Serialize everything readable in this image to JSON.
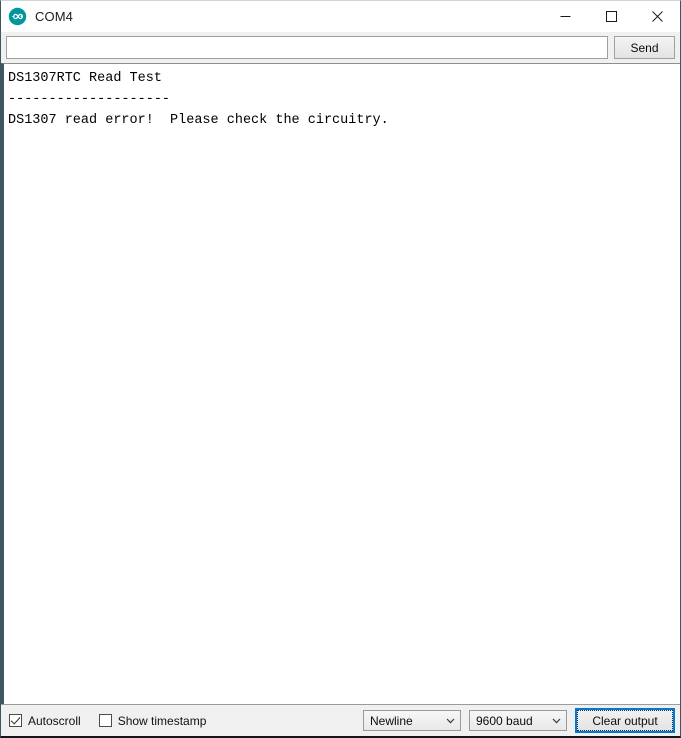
{
  "window": {
    "title": "COM4",
    "app_icon": "arduino-logo-icon",
    "controls": {
      "minimize": "minimize-icon",
      "maximize": "maximize-icon",
      "close": "close-icon"
    }
  },
  "send_bar": {
    "input_value": "",
    "input_placeholder": "",
    "send_label": "Send"
  },
  "console": {
    "lines": [
      "DS1307RTC Read Test",
      "--------------------",
      "DS1307 read error!  Please check the circuitry."
    ]
  },
  "toolbar": {
    "autoscroll": {
      "label": "Autoscroll",
      "checked": true
    },
    "show_timestamp": {
      "label": "Show timestamp",
      "checked": false
    },
    "line_ending": {
      "selected": "Newline",
      "icon": "chevron-down-icon"
    },
    "baud_rate": {
      "selected": "9600 baud",
      "icon": "chevron-down-icon"
    },
    "clear_output_label": "Clear output"
  },
  "colors": {
    "accent": "#0078d7",
    "arduino_teal": "#00979c",
    "toolbar_bg": "#f0f0f0",
    "console_bg": "#ffffff",
    "text": "#000000"
  }
}
